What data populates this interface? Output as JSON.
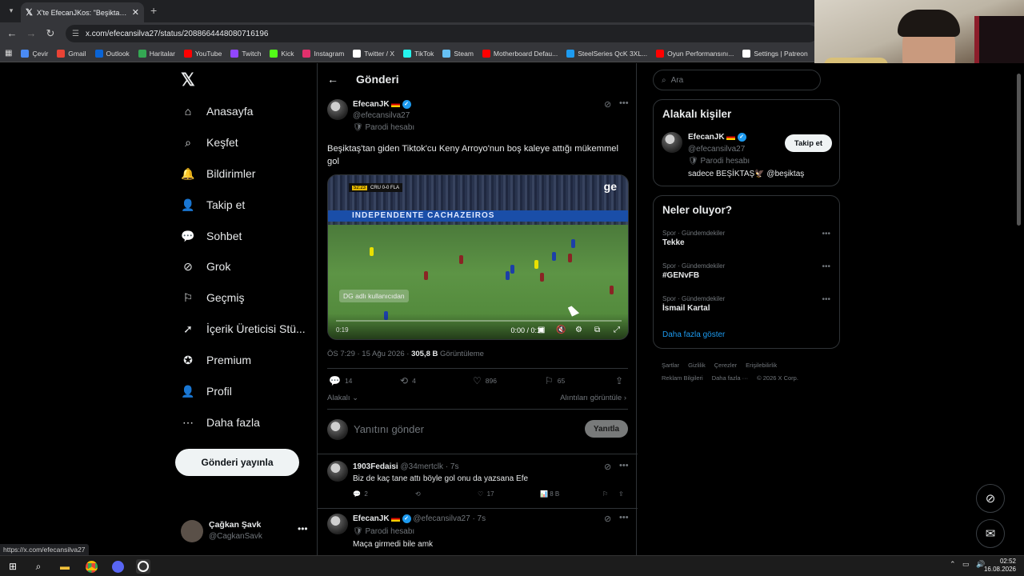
{
  "browser": {
    "tab_title": "X'te EfecanJKos: \"Beşiktaş'tan giden",
    "url": "x.com/efecansilva27/status/2088664448080716196",
    "bookmarks": [
      {
        "label": "Çevir",
        "color": "#4a8af4"
      },
      {
        "label": "Gmail",
        "color": "#ea4335"
      },
      {
        "label": "Outlook",
        "color": "#0a64d6"
      },
      {
        "label": "Haritalar",
        "color": "#34a853"
      },
      {
        "label": "YouTube",
        "color": "#ff0000"
      },
      {
        "label": "Twitch",
        "color": "#9146ff"
      },
      {
        "label": "Kick",
        "color": "#53fc18"
      },
      {
        "label": "Instagram",
        "color": "#e1306c"
      },
      {
        "label": "Twitter / X",
        "color": "#ffffff"
      },
      {
        "label": "TikTok",
        "color": "#25f4ee"
      },
      {
        "label": "Steam",
        "color": "#66c0f4"
      },
      {
        "label": "Motherboard Defau...",
        "color": "#ff0000"
      },
      {
        "label": "SteelSeries QcK 3XL...",
        "color": "#1d9bf0"
      },
      {
        "label": "Oyun Performansını...",
        "color": "#ff0000"
      },
      {
        "label": "Settings | Patreon",
        "color": "#ffffff"
      },
      {
        "label": "FIF",
        "color": "#ff6a00"
      }
    ],
    "status_url": "https://x.com/efecansilva27"
  },
  "nav": {
    "items": [
      {
        "label": "Anasayfa",
        "icon": "home-icon"
      },
      {
        "label": "Keşfet",
        "icon": "search-icon"
      },
      {
        "label": "Bildirimler",
        "icon": "bell-icon"
      },
      {
        "label": "Takip et",
        "icon": "follow-icon"
      },
      {
        "label": "Sohbet",
        "icon": "chat-icon"
      },
      {
        "label": "Grok",
        "icon": "grok-icon"
      },
      {
        "label": "Geçmiş",
        "icon": "bookmark-icon"
      },
      {
        "label": "İçerik Üreticisi Stü...",
        "icon": "rocket-icon"
      },
      {
        "label": "Premium",
        "icon": "verified-icon"
      },
      {
        "label": "Profil",
        "icon": "profile-icon"
      },
      {
        "label": "Daha fazla",
        "icon": "more-icon"
      }
    ],
    "post_button": "Gönderi yayınla",
    "account": {
      "name": "Çağkan Şavk",
      "handle": "@CagkanSavk"
    }
  },
  "post": {
    "header": "Gönderi",
    "author": "EfecanJK",
    "handle": "@efecansilva27",
    "parody": "Parodi hesabı",
    "text": "Beşiktaş'tan giden Tiktok'cu Keny Arroyo'nun boş kaleye attığı mükemmel gol",
    "video": {
      "score_time": "52:23",
      "score_text": "CRU 0-0 FLA",
      "channel": "ge",
      "board_text": "INDEPENDENTE   CACHAZEIROS",
      "watermark": "DG adlı kullanıcıdan",
      "elapsed": "0:19",
      "time": "0:00 / 0:19"
    },
    "meta_time": "ÖS 7:29 · 15 Ağu 2026 · ",
    "views": "305,8 B",
    "views_label": " Görüntüleme",
    "replies": "14",
    "reposts": "4",
    "likes": "896",
    "bookmarks": "65",
    "relevant": "Alakalı",
    "quotes": "Alıntıları görüntüle",
    "reply_placeholder": "Yanıtını gönder",
    "reply_button": "Yanıtla"
  },
  "replies": [
    {
      "author": "1903Fedaisi",
      "handle": "@34mertclk · 7s",
      "text": "Biz de kaç tane attı böyle gol onu da yazsana Efe",
      "replies": "2",
      "likes": "17",
      "views": "8 B"
    },
    {
      "author": "EfecanJK",
      "handle": "@efecansilva27 · 7s",
      "parody": "Parodi hesabı",
      "text": "Maça girmedi bile amk"
    }
  ],
  "sidebar": {
    "search_placeholder": "Ara",
    "who_title": "Alakalı kişiler",
    "who": {
      "name": "EfecanJK",
      "handle": "@efecansilva27",
      "parody": "Parodi hesabı",
      "bio": "sadece BEŞİKTAŞ🦅 @beşiktaş",
      "follow": "Takip et"
    },
    "trends_title": "Neler oluyor?",
    "trends": [
      {
        "category": "Spor · Gündemdekiler",
        "title": "Tekke"
      },
      {
        "category": "Spor · Gündemdekiler",
        "title": "#GENvFB"
      },
      {
        "category": "Spor · Gündemdekiler",
        "title": "İsmail Kartal"
      }
    ],
    "more": "Daha fazla göster",
    "footer": [
      "Şartlar",
      "Gizlilik",
      "Çerezler",
      "Erişilebilirlik",
      "Reklam Bilgileri",
      "Daha fazla ···",
      "© 2026 X Corp."
    ]
  },
  "taskbar": {
    "time": "02:52",
    "date": "16.08.2026"
  }
}
